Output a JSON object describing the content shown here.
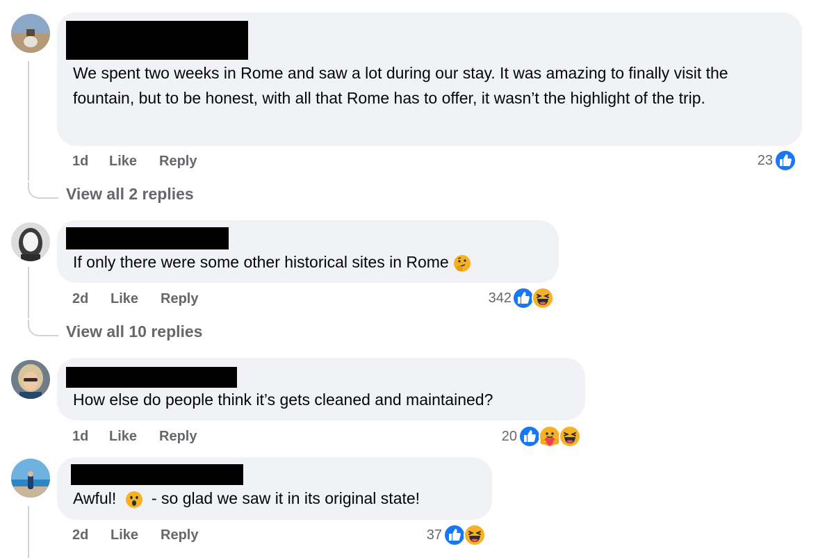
{
  "comments": [
    {
      "text": "We spent two weeks in Rome and saw a lot during our stay. It was amazing to finally visit the fountain, but to be honest, with all that Rome has to offer, it wasn’t the highlight of the trip.",
      "time": "1d",
      "like": "Like",
      "reply": "Reply",
      "reaction_count": "23",
      "reactions": [
        "like-icon"
      ],
      "view_replies": "View all 2 replies"
    },
    {
      "text": "If only there were some other historical sites in Rome",
      "inline_emoji": "thinking-face-emoji",
      "time": "2d",
      "like": "Like",
      "reply": "Reply",
      "reaction_count": "342",
      "reactions": [
        "like-icon",
        "haha-icon"
      ],
      "view_replies": "View all 10 replies"
    },
    {
      "text": "How else do people think it’s gets cleaned and maintained?",
      "time": "1d",
      "like": "Like",
      "reply": "Reply",
      "reaction_count": "20",
      "reactions": [
        "like-icon",
        "care-icon",
        "haha-icon"
      ]
    },
    {
      "text_before": "Awful!",
      "inline_emoji": "wow-face-emoji",
      "text_after": "- so glad we saw it in its original state!",
      "time": "2d",
      "like": "Like",
      "reply": "Reply",
      "reaction_count": "37",
      "reactions": [
        "like-icon",
        "haha-icon"
      ]
    }
  ],
  "colors": {
    "bubble": "#f0f2f5",
    "meta_text": "#65676b",
    "like_blue": "#1877f2",
    "emoji_yellow": "#f7b125",
    "thread_line": "#cfd3d8"
  }
}
